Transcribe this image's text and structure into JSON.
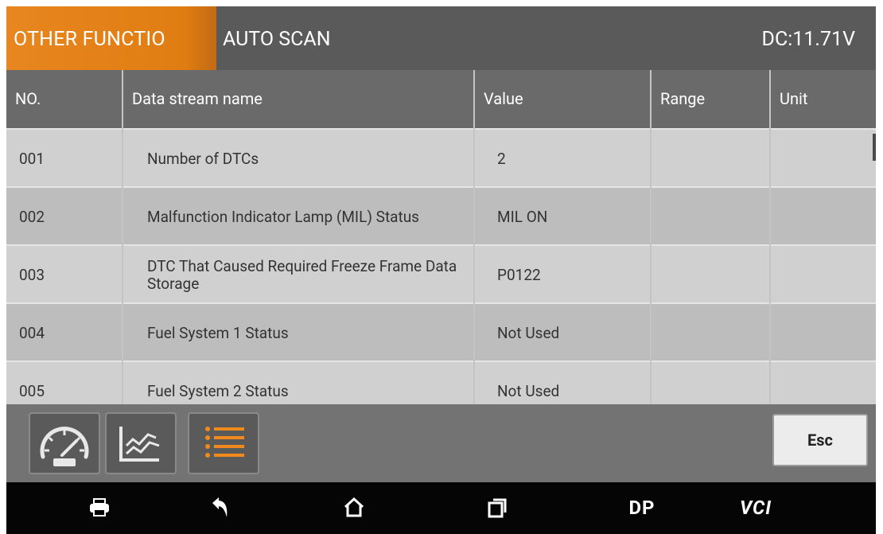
{
  "header": {
    "active_tab": "OTHER FUNCTIO",
    "second_tab": "AUTO SCAN",
    "voltage": "DC:11.71V"
  },
  "table": {
    "columns": [
      "NO.",
      "Data stream name",
      "Value",
      "Range",
      "Unit"
    ],
    "rows": [
      {
        "no": "001",
        "name": "Number of DTCs",
        "value": "2",
        "range": "",
        "unit": ""
      },
      {
        "no": "002",
        "name": "Malfunction Indicator Lamp (MIL) Status",
        "value": "MIL ON",
        "range": "",
        "unit": ""
      },
      {
        "no": "003",
        "name": "DTC That Caused Required Freeze Frame Data Storage",
        "value": "P0122",
        "range": "",
        "unit": ""
      },
      {
        "no": "004",
        "name": "Fuel System 1 Status",
        "value": "Not Used",
        "range": "",
        "unit": ""
      },
      {
        "no": "005",
        "name": "Fuel System 2 Status",
        "value": "Not Used",
        "range": "",
        "unit": ""
      }
    ]
  },
  "toolbar": {
    "buttons": [
      {
        "icon": "gauge-icon"
      },
      {
        "icon": "line-graph-icon"
      },
      {
        "icon": "list-icon",
        "active": true
      }
    ],
    "esc_label": "Esc",
    "accent_color": "#f08a1c"
  },
  "navbar": {
    "items": [
      {
        "icon": "print-icon"
      },
      {
        "icon": "back-icon"
      },
      {
        "icon": "home-icon"
      },
      {
        "icon": "recent-apps-icon"
      },
      {
        "label": "DP"
      },
      {
        "label": "VCI"
      }
    ]
  }
}
